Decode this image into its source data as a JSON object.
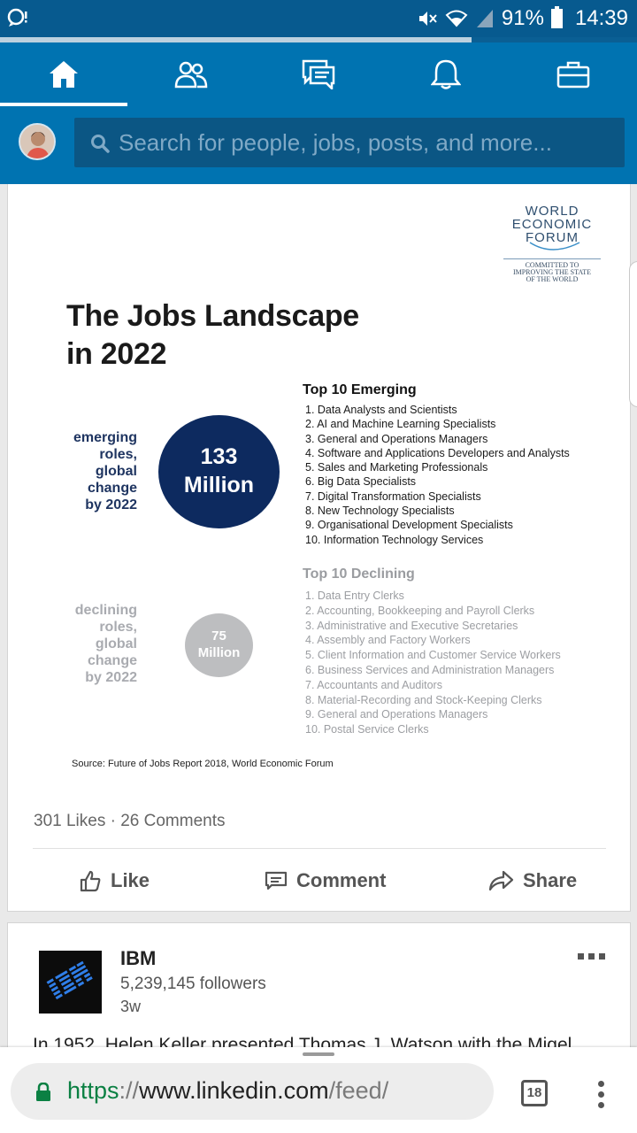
{
  "status_bar": {
    "battery": "91%",
    "time": "14:39",
    "page_load_progress": 0.74
  },
  "nav": {
    "items": [
      "home",
      "my-network",
      "messaging",
      "notifications",
      "jobs"
    ],
    "active": "home"
  },
  "search": {
    "placeholder": "Search for people, jobs, posts, and more..."
  },
  "post": {
    "infographic": {
      "org": [
        "WORLD",
        "ECONOMIC",
        "FORUM"
      ],
      "tagline": [
        "COMMITTED TO",
        "IMPROVING THE STATE",
        "OF THE WORLD"
      ],
      "title_line1": "The Jobs Landscape",
      "title_line2": "in 2022",
      "emerging": {
        "label": [
          "emerging",
          "roles,",
          "global",
          "change",
          "by 2022"
        ],
        "value_line1": "133",
        "value_line2": "Million",
        "list_title": "Top 10 Emerging",
        "items": [
          "1. Data Analysts and Scientists",
          "2. AI and Machine Learning Specialists",
          "3. General and Operations Managers",
          "4. Software and Applications Developers and Analysts",
          "5. Sales and Marketing Professionals",
          "6. Big Data Specialists",
          "7. Digital Transformation Specialists",
          "8. New Technology Specialists",
          "9. Organisational Development Specialists",
          "10. Information Technology Services"
        ]
      },
      "declining": {
        "label": [
          "declining",
          "roles,",
          "global",
          "change",
          "by 2022"
        ],
        "value_line1": "75",
        "value_line2": "Million",
        "list_title": "Top 10 Declining",
        "items": [
          "1.  Data Entry Clerks",
          "2.  Accounting,  Bookkeeping and Payroll Clerks",
          "3.  Administrative and Executive Secretaries",
          "4.  Assembly and Factory Workers",
          "5.  Client Information and Customer Service Workers",
          "6.  Business Services and Administration Managers",
          "7.  Accountants and Auditors",
          "8.  Material-Recording and Stock-Keeping Clerks",
          "9.  General and Operations Managers",
          "10. Postal Service Clerks"
        ]
      },
      "source": "Source: Future of Jobs Report 2018, World Economic Forum"
    },
    "social_counts": "301 Likes · 26 Comments",
    "actions": {
      "like": "Like",
      "comment": "Comment",
      "share": "Share"
    }
  },
  "next_post": {
    "company": "IBM",
    "followers": "5,239,145 followers",
    "time": "3w",
    "text": "In 1952, Helen Keller presented Thomas J. Watson with the Migel"
  },
  "browser": {
    "url_scheme": "https",
    "url_sep": "://",
    "url_host": "www.linkedin.com",
    "url_path": "/feed/",
    "tab_count": "18"
  }
}
